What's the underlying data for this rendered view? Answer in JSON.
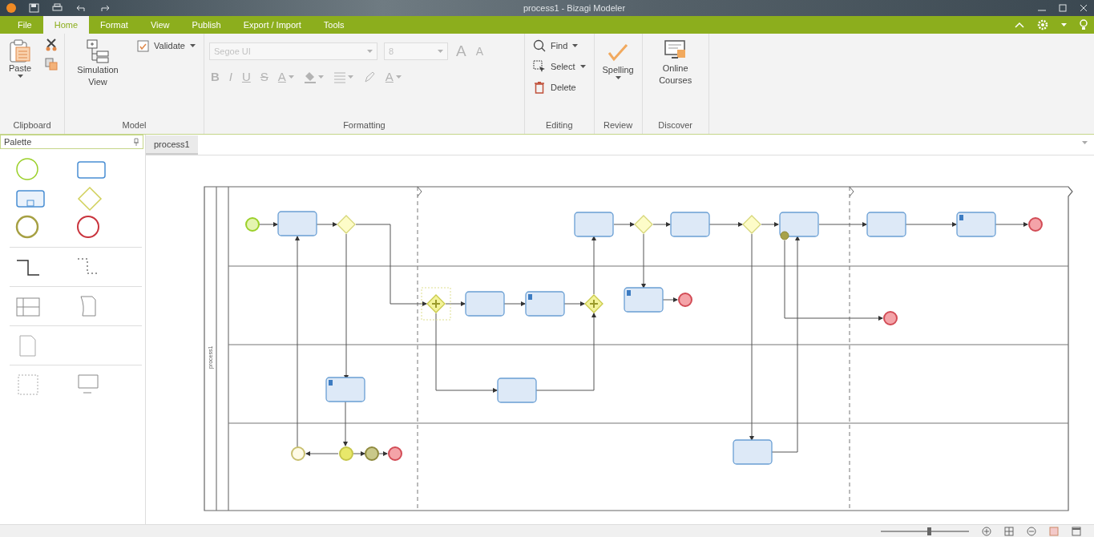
{
  "window": {
    "title": "process1 - Bizagi Modeler"
  },
  "ribbon_tabs": [
    {
      "label": "File",
      "selected": false
    },
    {
      "label": "Home",
      "selected": true
    },
    {
      "label": "Format",
      "selected": false
    },
    {
      "label": "View",
      "selected": false
    },
    {
      "label": "Publish",
      "selected": false
    },
    {
      "label": "Export / Import",
      "selected": false
    },
    {
      "label": "Tools",
      "selected": false
    }
  ],
  "ribbon_groups": [
    {
      "label": "Clipboard",
      "disabled": false,
      "columns": [
        [
          {
            "kind": "large",
            "label": "Paste",
            "dropdown": true
          }
        ],
        [
          {
            "kind": "icon",
            "dropdown": false
          },
          {
            "kind": "icon",
            "dropdown": false
          }
        ]
      ]
    },
    {
      "label": "Model",
      "disabled": false,
      "columns": [
        [
          {
            "kind": "large",
            "label": "Simulation View",
            "dropdown": false
          }
        ],
        [
          {
            "kind": "small",
            "label": "Validate",
            "dropdown": true
          }
        ]
      ]
    },
    {
      "label": "Formatting",
      "disabled": true,
      "lines": [
        {
          "controls": [
            {
              "kind": "field",
              "value": "Segoe UI"
            },
            {
              "kind": "field",
              "value": "8"
            },
            {
              "kind": "glyph",
              "label": "A",
              "dropdown": false
            },
            {
              "kind": "glyph",
              "label": "A",
              "dropdown": false
            }
          ]
        },
        {
          "controls": [
            {
              "kind": "glyph",
              "label": "B",
              "dropdown": false
            },
            {
              "kind": "glyph",
              "label": "I",
              "dropdown": false
            },
            {
              "kind": "glyph",
              "label": "U",
              "dropdown": false
            },
            {
              "kind": "glyph",
              "label": "S",
              "dropdown": false
            },
            {
              "kind": "glyph",
              "label": "A",
              "dropdown": true
            },
            {
              "kind": "icon",
              "dropdown": true
            },
            {
              "kind": "icon",
              "dropdown": true
            },
            {
              "kind": "icon",
              "dropdown": false
            },
            {
              "kind": "glyph",
              "label": "A",
              "dropdown": true
            }
          ]
        }
      ]
    },
    {
      "label": "Editing",
      "disabled": false,
      "columns": [
        [
          {
            "kind": "small",
            "label": "Find",
            "dropdown": true
          },
          {
            "kind": "small",
            "label": "Select",
            "dropdown": true
          },
          {
            "kind": "small",
            "label": "Delete",
            "dropdown": false
          }
        ]
      ]
    },
    {
      "label": "Review",
      "disabled": false,
      "columns": [
        [
          {
            "kind": "large",
            "label": "Spelling",
            "dropdown": true
          }
        ]
      ]
    },
    {
      "label": "Discover",
      "disabled": false,
      "columns": [
        [
          {
            "kind": "large",
            "label": "Online Courses",
            "dropdown": false
          }
        ]
      ]
    }
  ],
  "palette": {
    "title": "Palette"
  },
  "document_tabs": [
    {
      "label": "process1",
      "selected": true
    }
  ],
  "diagram": {
    "pool_label": "process1",
    "nodes": [
      {
        "kind": "start",
        "selected": false
      },
      {
        "kind": "task",
        "selected": false
      },
      {
        "kind": "gateway",
        "selected": false
      },
      {
        "kind": "task",
        "selected": false
      },
      {
        "kind": "gateway",
        "selected": false
      },
      {
        "kind": "task",
        "selected": false
      },
      {
        "kind": "gateway",
        "selected": false
      },
      {
        "kind": "task",
        "selected": false
      },
      {
        "kind": "boundary",
        "selected": false
      },
      {
        "kind": "task",
        "selected": false
      },
      {
        "kind": "marked-task",
        "selected": false
      },
      {
        "kind": "end",
        "selected": false
      },
      {
        "kind": "parallel",
        "selected": true
      },
      {
        "kind": "task",
        "selected": false
      },
      {
        "kind": "marked-task",
        "selected": false
      },
      {
        "kind": "parallel",
        "selected": false
      },
      {
        "kind": "marked-task",
        "selected": false
      },
      {
        "kind": "end",
        "selected": false
      },
      {
        "kind": "end",
        "selected": false
      },
      {
        "kind": "marked-task",
        "selected": false
      },
      {
        "kind": "task",
        "selected": false
      },
      {
        "kind": "intermediate",
        "selected": false
      },
      {
        "kind": "signal",
        "selected": false
      },
      {
        "kind": "catch",
        "selected": false
      },
      {
        "kind": "end",
        "selected": false
      },
      {
        "kind": "task",
        "selected": false
      }
    ]
  },
  "status_bar": {
    "zoom_slider": {
      "level": 0.55
    }
  }
}
